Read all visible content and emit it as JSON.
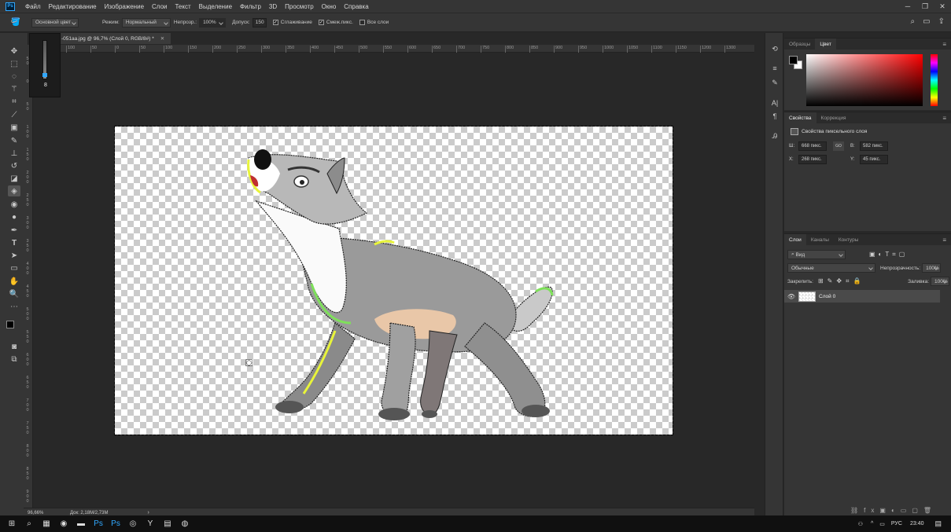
{
  "menu": {
    "items": [
      "Файл",
      "Редактирование",
      "Изображение",
      "Слои",
      "Текст",
      "Выделение",
      "Фильтр",
      "3D",
      "Просмотр",
      "Окно",
      "Справка"
    ]
  },
  "options": {
    "fill_source": "Основной цвет",
    "mode_label": "Режим:",
    "mode_value": "Нормальный",
    "opacity_label": "Непрозр.:",
    "opacity_value": "100%",
    "tolerance_label": "Допуск:",
    "tolerance_value": "150",
    "antialias_label": "Сглаживание",
    "contiguous_label": "Смеж.пикс.",
    "all_layers_label": "Все слои",
    "antialias_checked": true,
    "contiguous_checked": true,
    "all_layers_checked": false
  },
  "doc": {
    "tab_title": "-051aa.jpg @ 96,7% (Слой 0, RGB/8#) *"
  },
  "brush_popup": {
    "size": "8"
  },
  "ruler": {
    "h": [
      "100",
      "50",
      "0",
      "50",
      "100",
      "150",
      "200",
      "250",
      "300",
      "350",
      "400",
      "450",
      "500",
      "550",
      "600",
      "650",
      "700",
      "750",
      "800",
      "850",
      "900",
      "950",
      "1000",
      "1050",
      "1100",
      "1150",
      "1200",
      "1300"
    ],
    "v": [
      "50",
      "0",
      "50",
      "100",
      "150",
      "200",
      "250",
      "300",
      "350",
      "400",
      "450",
      "500",
      "550",
      "600",
      "650",
      "700",
      "750",
      "800",
      "850",
      "900"
    ]
  },
  "status": {
    "zoom": "96,66%",
    "doc_size": "Док: 2,18M/2,73M"
  },
  "color_panel": {
    "tab_swatches": "Образцы",
    "tab_color": "Цвет",
    "hue_color": "#ff0000"
  },
  "properties": {
    "tab_props": "Свойства",
    "tab_adjust": "Коррекция",
    "title": "Свойства пиксельного слоя",
    "w_label": "Ш:",
    "w_value": "668 пикс.",
    "h_label": "В:",
    "h_value": "582 пикс.",
    "x_label": "X:",
    "x_value": "268 пикс.",
    "y_label": "Y:",
    "y_value": "45 пикс.",
    "link_label": "GO"
  },
  "layers": {
    "tab_layers": "Слои",
    "tab_channels": "Каналы",
    "tab_paths": "Контуры",
    "filter_label": "Вид",
    "blend_mode": "Обычные",
    "opacity_label": "Непрозрачность:",
    "opacity_value": "100%",
    "lock_label": "Закрепить:",
    "fill_label": "Заливка:",
    "fill_value": "100%",
    "items": [
      {
        "name": "Слой 0"
      }
    ]
  },
  "taskbar": {
    "lang": "РУС",
    "time": "23:40"
  },
  "colors": {
    "canvas_bg": "#282828",
    "panel_bg": "#353535",
    "accent": "#31a8ff"
  }
}
